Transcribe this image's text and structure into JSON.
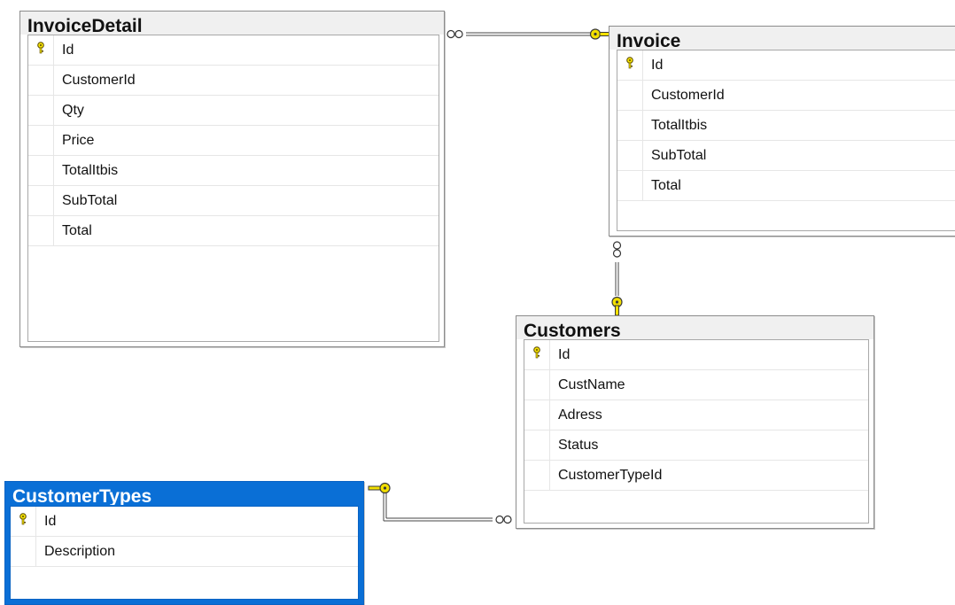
{
  "colors": {
    "key": "#f3e000",
    "selected_header": "#0a6fd6",
    "line": "#444444"
  },
  "icons": {
    "primary_key": "key-icon",
    "one_end": "key-connector-icon",
    "many_end": "infinity-connector-icon"
  },
  "tables": {
    "invoice_detail": {
      "name": "InvoiceDetail",
      "columns": [
        "Id",
        "CustomerId",
        "Qty",
        "Price",
        "TotalItbis",
        "SubTotal",
        "Total"
      ]
    },
    "invoice": {
      "name": "Invoice",
      "columns": [
        "Id",
        "CustomerId",
        "TotalItbis",
        "SubTotal",
        "Total"
      ]
    },
    "customers": {
      "name": "Customers",
      "columns": [
        "Id",
        "CustName",
        "Adress",
        "Status",
        "CustomerTypeId"
      ]
    },
    "customer_types": {
      "name": "CustomerTypes",
      "selected": true,
      "columns": [
        "Id",
        "Description"
      ]
    }
  }
}
